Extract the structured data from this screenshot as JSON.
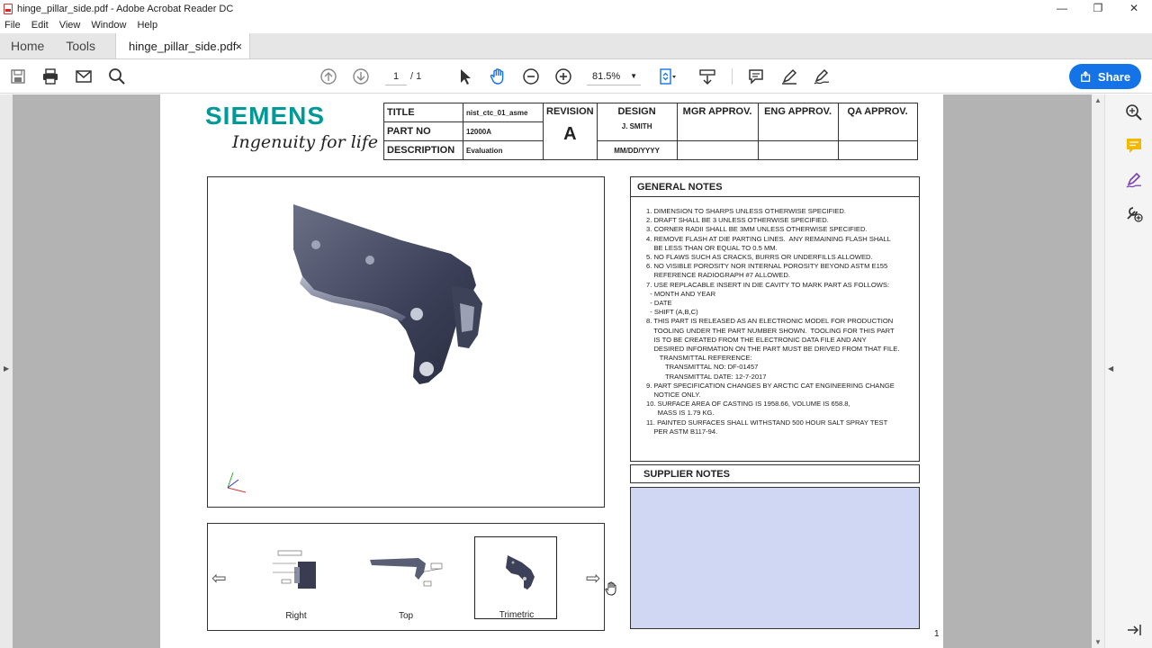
{
  "window": {
    "title": "hinge_pillar_side.pdf - Adobe Acrobat Reader DC",
    "controls": [
      "—",
      "❐",
      "✕"
    ]
  },
  "menu": [
    "File",
    "Edit",
    "View",
    "Window",
    "Help"
  ],
  "tabs": {
    "home": "Home",
    "tools": "Tools",
    "document": "hinge_pillar_side.pdf",
    "close": "×"
  },
  "toolbar": {
    "page_current": "1",
    "page_total": "/ 1",
    "zoom": "81.5%",
    "share_label": "Share",
    "icons": [
      "save-icon",
      "print-icon",
      "email-icon",
      "search-icon",
      "prev-page-icon",
      "next-page-icon",
      "select-cursor-icon",
      "hand-tool-icon",
      "zoom-out-icon",
      "zoom-in-icon",
      "fit-page-icon",
      "scroll-mode-icon",
      "comment-icon",
      "highlight-icon",
      "sign-icon"
    ]
  },
  "drawing": {
    "logo_name": "SIEMENS",
    "logo_tagline": "Ingenuity for life",
    "title_block": {
      "title_label": "TITLE",
      "title_value": "nist_ctc_01_asme",
      "partno_label": "PART NO",
      "partno_value": "12000A",
      "desc_label": "DESCRIPTION",
      "desc_value": "Evaluation",
      "revision_label": "REVISION",
      "revision_value": "A",
      "design_label": "DESIGN",
      "design_name": "J. SMITH",
      "design_date": "MM/DD/YYYY",
      "mgr_label": "MGR APPROV.",
      "eng_label": "ENG APPROV.",
      "qa_label": "QA APPROV."
    },
    "general_notes_title": "GENERAL NOTES",
    "general_notes": [
      "1. DIMENSION TO SHARPS UNLESS OTHERWISE SPECIFIED.",
      "2. DRAFT SHALL BE 3 UNLESS OTHERWISE SPECIFIED.",
      "3. CORNER RADII SHALL BE 3MM UNLESS OTHERWISE SPECIFIED.",
      "4. REMOVE FLASH AT DIE PARTING LINES.  ANY REMAINING FLASH SHALL",
      "    BE LESS THAN OR EQUAL TO 0.5 MM.",
      "5. NO FLAWS SUCH AS CRACKS, BURRS OR UNDERFILLS ALLOWED.",
      "6. NO VISIBLE POROSITY NOR INTERNAL POROSITY BEYOND ASTM E155",
      "    REFERENCE RADIOGRAPH #7 ALLOWED.",
      "7. USE REPLACABLE INSERT IN DIE CAVITY TO MARK PART AS FOLLOWS:",
      "  - MONTH AND YEAR",
      "  - DATE",
      "  - SHIFT (A,B,C)",
      "8. THIS PART IS RELEASED AS AN ELECTRONIC MODEL FOR PRODUCTION",
      "    TOOLING UNDER THE PART NUMBER SHOWN.  TOOLING FOR THIS PART",
      "    IS TO BE CREATED FROM THE ELECTRONIC DATA FILE AND ANY",
      "    DESIRED INFORMATION ON THE PART MUST BE DRIVED FROM THAT FILE.",
      "       TRANSMITTAL REFERENCE:",
      "          TRANSMITTAL NO: DF-01457",
      "          TRANSMITTAL DATE: 12-7-2017",
      "9. PART SPECIFICATION CHANGES BY ARCTIC CAT ENGINEERING CHANGE",
      "    NOTICE ONLY.",
      "10. SURFACE AREA OF CASTING IS 1958.66, VOLUME IS 658.8,",
      "      MASS IS 1.79 KG.",
      "11. PAINTED SURFACES SHALL WITHSTAND 500 HOUR SALT SPRAY TEST",
      "    PER ASTM B117-94."
    ],
    "supplier_notes_title": "SUPPLIER NOTES",
    "views": [
      "Right",
      "Top",
      "Trimetric"
    ],
    "page_number": "1"
  },
  "colors": {
    "siemens_teal": "#009999",
    "share_blue": "#1473e6",
    "supplier_fill": "#cfd7f2",
    "workspace_gray": "#b3b3b3"
  }
}
